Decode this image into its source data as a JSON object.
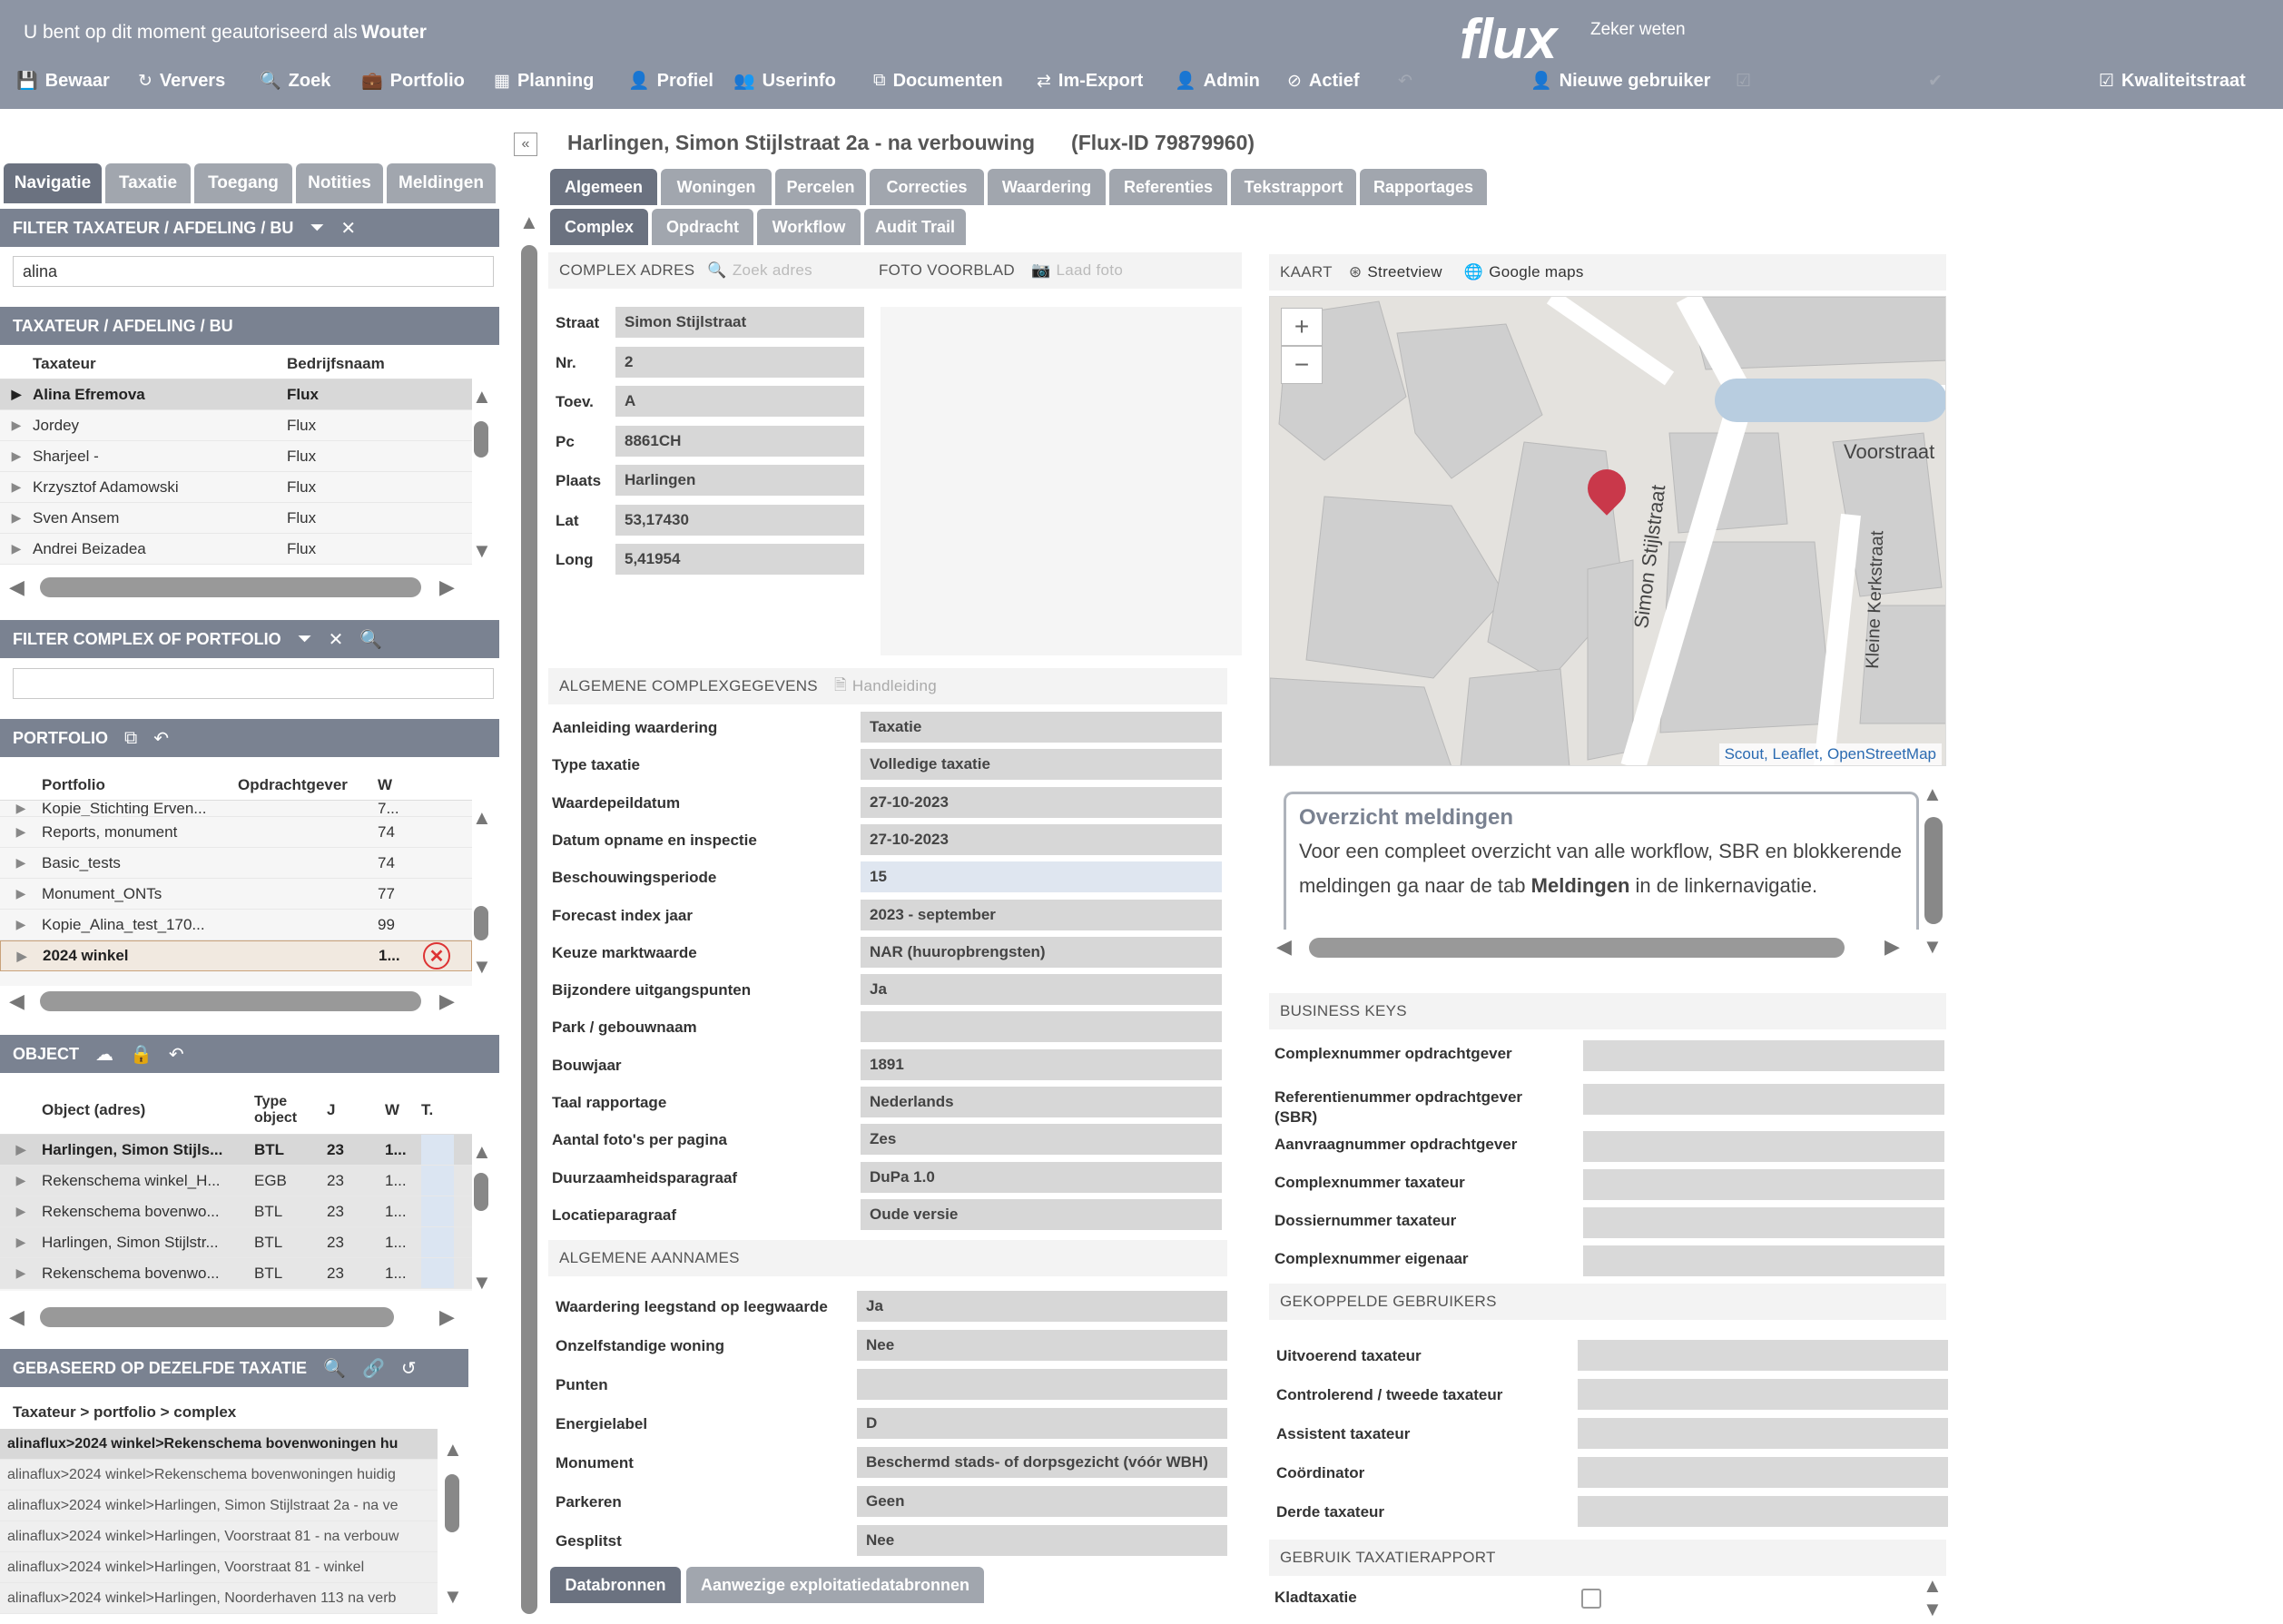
{
  "header": {
    "auth_text": "U bent op dit moment geautoriseerd als",
    "user": "Wouter",
    "logo": "flux",
    "logo_sub": "Zeker weten"
  },
  "toolbar": [
    {
      "label": "Bewaar",
      "icon": "save-icon",
      "glyph": "💾"
    },
    {
      "label": "Ververs",
      "icon": "refresh-icon",
      "glyph": "↻"
    },
    {
      "label": "Zoek",
      "icon": "search-icon",
      "glyph": "🔍"
    },
    {
      "label": "Portfolio",
      "icon": "briefcase-icon",
      "glyph": "💼"
    },
    {
      "label": "Planning",
      "icon": "calendar-icon",
      "glyph": "▦"
    },
    {
      "label": "Profiel",
      "icon": "user-icon",
      "glyph": "👤"
    },
    {
      "label": "Userinfo",
      "icon": "users-icon",
      "glyph": "👥"
    },
    {
      "label": "Documenten",
      "icon": "documents-icon",
      "glyph": "⧉"
    },
    {
      "label": "Im-Export",
      "icon": "import-export-icon",
      "glyph": "⇄"
    },
    {
      "label": "Admin",
      "icon": "admin-icon",
      "glyph": "👤"
    },
    {
      "label": "Actief",
      "icon": "ban-icon",
      "glyph": "⊘"
    },
    {
      "label": "",
      "icon": "undo-icon",
      "glyph": "↶",
      "disabled": true
    },
    {
      "label": "Nieuwe gebruiker",
      "icon": "add-user-icon",
      "glyph": "👤"
    },
    {
      "label": "",
      "icon": "checklist-icon",
      "glyph": "☑",
      "disabled": true
    },
    {
      "label": "",
      "icon": "check-icon",
      "glyph": "✔",
      "disabled": true
    },
    {
      "label": "Kwaliteitstraat",
      "icon": "checkbox-icon",
      "glyph": "☑"
    }
  ],
  "left_tabs": [
    "Navigatie",
    "Taxatie",
    "Toegang",
    "Notities",
    "Meldingen"
  ],
  "filter_taxateur": {
    "title": "FILTER TAXATEUR / AFDELING / BU",
    "value": "alina"
  },
  "taxateur_list": {
    "title": "TAXATEUR / AFDELING / BU",
    "headers": [
      "Taxateur",
      "Bedrijfsnaam"
    ],
    "rows": [
      [
        "Alina Efremova",
        "Flux"
      ],
      [
        "Jordey",
        "Flux"
      ],
      [
        "Sharjeel -",
        "Flux"
      ],
      [
        "Krzysztof Adamowski",
        "Flux"
      ],
      [
        "Sven Ansem",
        "Flux"
      ],
      [
        "Andrei Beizadea",
        "Flux"
      ]
    ]
  },
  "filter_complex": {
    "title": "FILTER COMPLEX OF PORTFOLIO",
    "value": ""
  },
  "portfolio": {
    "title": "PORTFOLIO",
    "headers": [
      "Portfolio",
      "Opdrachtgever",
      "W"
    ],
    "rows": [
      [
        "Kopie_Stichting Erven...",
        "",
        "7..."
      ],
      [
        "Reports, monument",
        "",
        "74"
      ],
      [
        "Basic_tests",
        "",
        "74"
      ],
      [
        "Monument_ONTs",
        "",
        "77"
      ],
      [
        "Kopie_Alina_test_170...",
        "",
        "99"
      ],
      [
        "2024 winkel",
        "",
        "1..."
      ]
    ]
  },
  "object": {
    "title": "OBJECT",
    "headers": [
      "Object (adres)",
      "Type object",
      "J",
      "W",
      "T."
    ],
    "rows": [
      [
        "Harlingen, Simon Stijls...",
        "BTL",
        "23",
        "1..."
      ],
      [
        "Rekenschema winkel_H...",
        "EGB",
        "23",
        "1..."
      ],
      [
        "Rekenschema bovenwo...",
        "BTL",
        "23",
        "1..."
      ],
      [
        "Harlingen, Simon Stijlstr...",
        "BTL",
        "23",
        "1..."
      ],
      [
        "Rekenschema bovenwo...",
        "BTL",
        "23",
        "1..."
      ]
    ]
  },
  "gebaseerd": {
    "title": "GEBASEERD OP DEZELFDE TAXATIE",
    "header": "Taxateur > portfolio > complex",
    "rows": [
      "alinaflux>2024 winkel>Rekenschema bovenwoningen hu",
      "alinaflux>2024 winkel>Rekenschema bovenwoningen huidig",
      "alinaflux>2024 winkel>Harlingen, Simon Stijlstraat 2a - na ve",
      "alinaflux>2024 winkel>Harlingen, Voorstraat 81 - na verbouw",
      "alinaflux>2024 winkel>Harlingen, Voorstraat 81 - winkel",
      "alinaflux>2024 winkel>Harlingen, Noorderhaven 113 na verb"
    ]
  },
  "main": {
    "title": "Harlingen, Simon Stijlstraat 2a - na verbouwing",
    "flux_id": "(Flux-ID 79879960)",
    "tabs1": [
      "Algemeen",
      "Woningen",
      "Percelen",
      "Correcties",
      "Waardering",
      "Referenties",
      "Tekstrapport",
      "Rapportages"
    ],
    "tabs2": [
      "Complex",
      "Opdracht",
      "Workflow",
      "Audit Trail"
    ],
    "complex_adres": "COMPLEX ADRES",
    "zoek_adres": "Zoek adres",
    "foto_voorblad": "FOTO VOORBLAD",
    "laad_foto": "Laad foto",
    "kaart": "KAART",
    "streetview": "Streetview",
    "google_maps": "Google maps",
    "address": [
      [
        "Straat",
        "Simon Stijlstraat"
      ],
      [
        "Nr.",
        "2"
      ],
      [
        "Toev.",
        "A"
      ],
      [
        "Pc",
        "8861CH"
      ],
      [
        "Plaats",
        "Harlingen"
      ],
      [
        "Lat",
        "53,17430"
      ],
      [
        "Long",
        "5,41954"
      ]
    ],
    "algemene_title": "ALGEMENE COMPLEXGEGEVENS",
    "handleiding": "Handleiding",
    "algemene": [
      [
        "Aanleiding waardering",
        "Taxatie"
      ],
      [
        "Type taxatie",
        "Volledige taxatie"
      ],
      [
        "Waardepeildatum",
        "27-10-2023"
      ],
      [
        "Datum opname en inspectie",
        "27-10-2023"
      ],
      [
        "Beschouwingsperiode",
        "15"
      ],
      [
        "Forecast index jaar",
        "2023 - september"
      ],
      [
        "Keuze marktwaarde",
        "NAR (huuropbrengsten)"
      ],
      [
        "Bijzondere uitgangspunten",
        "Ja"
      ],
      [
        "Park / gebouwnaam",
        ""
      ],
      [
        "Bouwjaar",
        "1891"
      ],
      [
        "Taal rapportage",
        "Nederlands"
      ],
      [
        "Aantal foto's per pagina",
        "Zes"
      ],
      [
        "Duurzaamheidsparagraaf",
        "DuPa 1.0"
      ],
      [
        "Locatieparagraaf",
        "Oude versie"
      ]
    ],
    "aannames_title": "ALGEMENE AANNAMES",
    "aannames": [
      [
        "Waardering leegstand op leegwaarde",
        "Ja"
      ],
      [
        "Onzelfstandige woning",
        "Nee"
      ],
      [
        "Punten",
        ""
      ],
      [
        "Energielabel",
        "D"
      ],
      [
        "Monument",
        "Beschermd stads- of dorpsgezicht (vóór WBH)"
      ],
      [
        "Parkeren",
        "Geen"
      ],
      [
        "Gesplitst",
        "Nee"
      ]
    ],
    "bottom_tabs": [
      "Databronnen",
      "Aanwezige exploitatiedatabronnen"
    ]
  },
  "map": {
    "attribution": "Scout, Leaflet, OpenStreetMap",
    "streets": [
      "Voorstraat",
      "Simon Stijlstraat",
      "Kleine Kerkstraat"
    ],
    "zoom_in": "+",
    "zoom_out": "−"
  },
  "meldingen": {
    "title": "Overzicht meldingen",
    "text1": "Voor een compleet overzicht van alle workflow, SBR en blokkerende meldingen ga naar de tab ",
    "bold": "Meldingen",
    "text2": " in de linkernavigatie."
  },
  "business_keys": {
    "title": "BUSINESS KEYS",
    "rows": [
      "Complexnummer opdrachtgever",
      "Referentienummer opdrachtgever (SBR)",
      "Aanvraagnummer opdrachtgever",
      "Complexnummer taxateur",
      "Dossiernummer taxateur",
      "Complexnummer eigenaar"
    ]
  },
  "gekoppelde": {
    "title": "GEKOPPELDE GEBRUIKERS",
    "rows": [
      "Uitvoerend taxateur",
      "Controlerend / tweede taxateur",
      "Assistent taxateur",
      "Coördinator",
      "Derde taxateur"
    ]
  },
  "gebruik": {
    "title": "GEBRUIK TAXATIERAPPORT",
    "rows": [
      "Kladtaxatie"
    ]
  }
}
